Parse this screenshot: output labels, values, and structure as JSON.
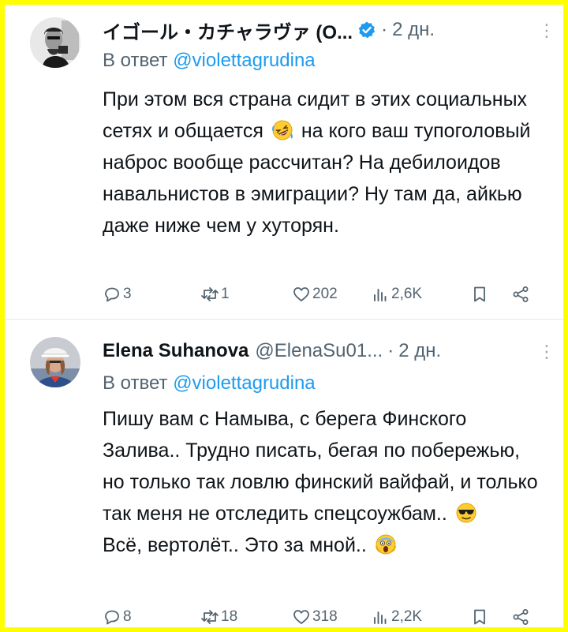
{
  "tweets": [
    {
      "display_name": "イゴール・カチャラヴァ (О...",
      "verified": true,
      "handle": "",
      "separator": "·",
      "time": "2 дн.",
      "reply_prefix": "В ответ",
      "reply_to": "@violettagrudina",
      "text_parts": [
        "При этом вся страна сидит в этих социальных сетях и общается",
        "на кого ваш тупоголовый наброс вообще рассчитан? На дебилоидов навальнистов в эмиграции? Ну там да, айкью даже ниже чем у хуторян."
      ],
      "emoji": "rolling-on-floor-laughing",
      "replies": "3",
      "retweets": "1",
      "likes": "202",
      "views": "2,6K"
    },
    {
      "display_name": "Elena Suhanova",
      "verified": false,
      "handle": "@ElenaSu01...",
      "separator": "·",
      "time": "2 дн.",
      "reply_prefix": "В ответ",
      "reply_to": "@violettagrudina",
      "text_parts": [
        "Пишу вам с Намыва, с берега Финского Залива.. Трудно писать, бегая по побережью, но только так ловлю финский вайфай, и только так меня не отследить спецсоужбам..",
        "Всё, вертолёт.. Это за мной.."
      ],
      "emoji_1": "smiling-face-with-sunglasses",
      "emoji_2": "face-screaming-in-fear",
      "replies": "8",
      "retweets": "18",
      "likes": "318",
      "views": "2,2K"
    }
  ],
  "colors": {
    "border": "#ffff00",
    "text": "#0f1419",
    "muted": "#536471",
    "link": "#1d9bf0",
    "verified": "#1d9bf0"
  }
}
